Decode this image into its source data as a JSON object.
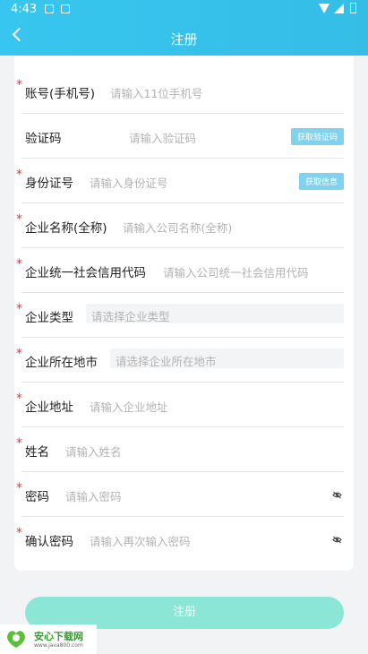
{
  "status": {
    "time": "4:43"
  },
  "header": {
    "title": "注册"
  },
  "form": {
    "fields": [
      {
        "label": "账号(手机号)",
        "placeholder": "请输入11位手机号",
        "required": true
      },
      {
        "label": "验证码",
        "placeholder": "请输入验证码",
        "required": false,
        "action": "获取验证码"
      },
      {
        "label": "身份证号",
        "placeholder": "请输入身份证号",
        "required": true,
        "action": "获取信息"
      },
      {
        "label": "企业名称(全称)",
        "placeholder": "请输入公司名称(全称)",
        "required": true
      },
      {
        "label": "企业统一社会信用代码",
        "placeholder": "请输入公司统一社会信用代码",
        "required": true
      },
      {
        "label": "企业类型",
        "placeholder": "请选择企业类型",
        "required": true
      },
      {
        "label": "企业所在地市",
        "placeholder": "请选择企业所在地市",
        "required": true
      },
      {
        "label": "企业地址",
        "placeholder": "请输入企业地址",
        "required": true
      },
      {
        "label": "姓名",
        "placeholder": "请输入姓名",
        "required": true
      },
      {
        "label": "密码",
        "placeholder": "请输入密码",
        "required": true
      },
      {
        "label": "确认密码",
        "placeholder": "请输入再次输入密码",
        "required": true
      }
    ]
  },
  "submit_label": "注册",
  "watermark": {
    "name": "安心下载网",
    "url": "www.java800.com"
  },
  "colors": {
    "header": "#37c6ef",
    "button": "#8be6d6",
    "required": "#e53935"
  },
  "icons": {
    "back": "chevron-left-icon",
    "eye": "eye-off-icon"
  }
}
